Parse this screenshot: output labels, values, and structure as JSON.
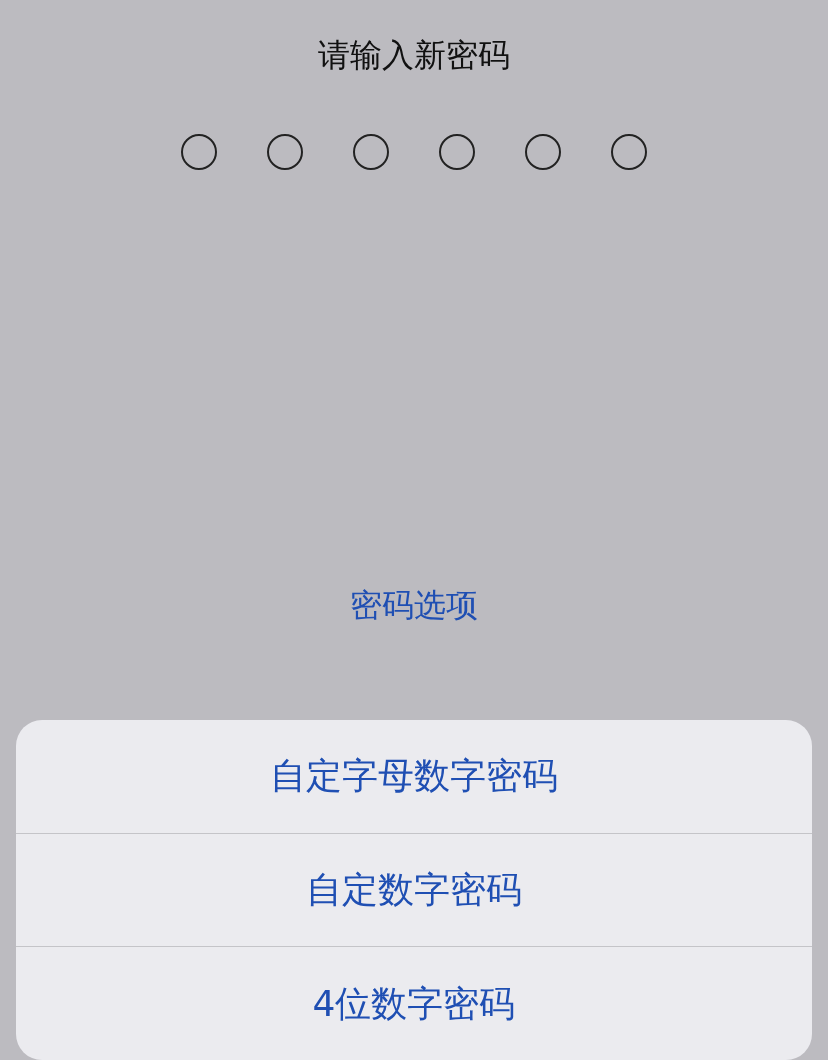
{
  "title": "请输入新密码",
  "passcode_dots": [
    {
      "filled": false
    },
    {
      "filled": false
    },
    {
      "filled": false
    },
    {
      "filled": false
    },
    {
      "filled": false
    },
    {
      "filled": false
    }
  ],
  "options_link": "密码选项",
  "action_sheet": {
    "items": [
      "自定字母数字密码",
      "自定数字密码",
      "4位数字密码"
    ]
  }
}
